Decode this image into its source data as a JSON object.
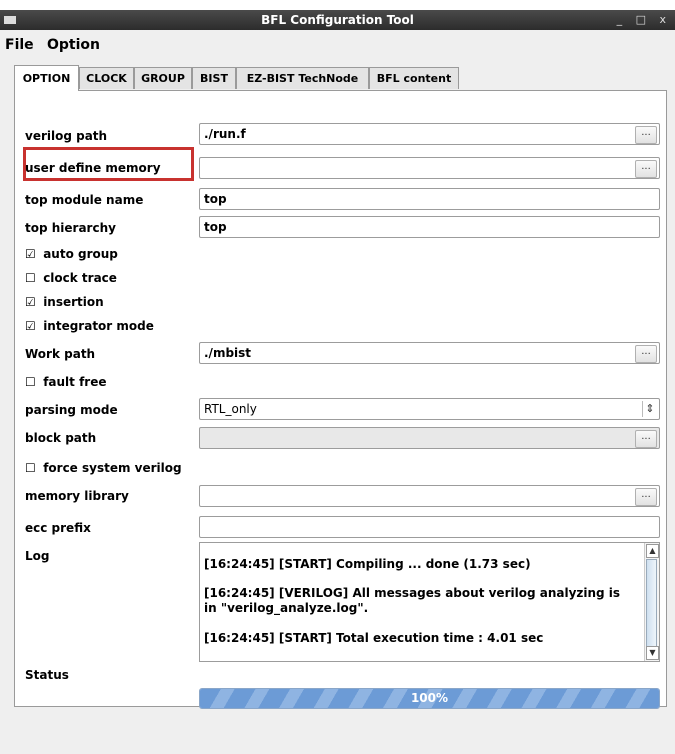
{
  "window": {
    "title": "BFL Configuration Tool",
    "controls": "_ □ x"
  },
  "menu": {
    "file": "File",
    "option": "Option"
  },
  "tabs": [
    "OPTION",
    "CLOCK",
    "GROUP",
    "BIST",
    "EZ-BIST TechNode",
    "BFL content"
  ],
  "active_tab": "OPTION",
  "form": {
    "verilog_path": {
      "label": "verilog path",
      "value": "./run.f",
      "browse": "..."
    },
    "user_define_memory": {
      "label": "user define memory",
      "value": "",
      "browse": "..."
    },
    "top_module_name": {
      "label": "top module name",
      "value": "top"
    },
    "top_hierarchy": {
      "label": "top hierarchy",
      "value": "top"
    },
    "auto_group": {
      "label": "auto group",
      "checked": true,
      "box": "☑"
    },
    "clock_trace": {
      "label": "clock trace",
      "checked": false,
      "box": "☐"
    },
    "insertion": {
      "label": "insertion",
      "checked": true,
      "box": "☑"
    },
    "integrator_mode": {
      "label": "integrator mode",
      "checked": true,
      "box": "☑"
    },
    "work_path": {
      "label": "Work path",
      "value": "./mbist",
      "browse": "..."
    },
    "fault_free": {
      "label": "fault free",
      "checked": false,
      "box": "☐"
    },
    "parsing_mode": {
      "label": "parsing mode",
      "value": "RTL_only",
      "spinner": "⇕"
    },
    "block_path": {
      "label": "block path",
      "value": "",
      "browse": "..."
    },
    "force_system_verilog": {
      "label": "force system verilog",
      "checked": false,
      "box": "☐"
    },
    "memory_library": {
      "label": "memory library",
      "value": "",
      "browse": "..."
    },
    "ecc_prefix": {
      "label": "ecc prefix",
      "value": ""
    }
  },
  "log": {
    "label": "Log",
    "lines": [
      "[16:24:45]  [START] Compiling ... done (1.73 sec)",
      "[16:24:45]  [VERILOG] All messages about verilog analyzing is in \"verilog_analyze.log\".",
      "[16:24:45]  [START] Total execution time : 4.01 sec"
    ],
    "scroll_up": "▲",
    "scroll_down": "▼"
  },
  "status": {
    "label": "Status",
    "progress_text": "100%",
    "progress": 1.0
  },
  "colors": {
    "highlight": "#c8322f",
    "progress": "#6c9bd6",
    "titlebar": "#3a3a3a"
  }
}
